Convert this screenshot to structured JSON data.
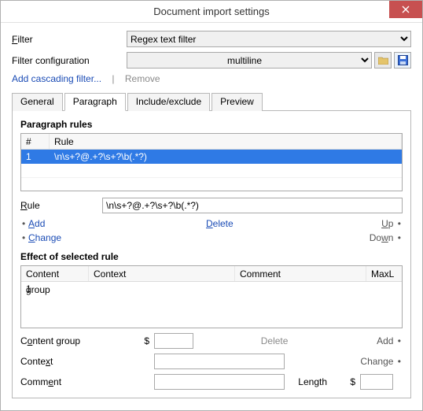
{
  "window": {
    "title": "Document import settings"
  },
  "filter_row": {
    "label": "Filter",
    "hotchar": "F",
    "value": "Regex text filter"
  },
  "filter_config_row": {
    "label": "Filter configuration",
    "value": "multiline"
  },
  "linkbar": {
    "add_cascading": "Add cascading filter...",
    "sep": "|",
    "remove": "Remove"
  },
  "tabs": {
    "general": "General",
    "paragraph": "Paragraph",
    "include": "Include/exclude",
    "preview": "Preview"
  },
  "para_rules": {
    "title": "Paragraph rules",
    "header_hash": "#",
    "header_rule": "Rule",
    "rows": [
      {
        "num": "1",
        "rule": "\\n\\s+?@.+?\\s+?\\b(.*?)"
      }
    ]
  },
  "rule_edit": {
    "label": "Rule",
    "hotchar": "R",
    "value": "\\n\\s+?@.+?\\s+?\\b(.*?)"
  },
  "rule_actions": {
    "add": "Add",
    "change": "Change",
    "delete": "Delete",
    "up": "Up",
    "down": "Down"
  },
  "effects": {
    "title": "Effect of selected rule",
    "header_group": "Content group",
    "header_context": "Context",
    "header_comment": "Comment",
    "header_maxl": "MaxL",
    "rows": [
      {
        "group": "1",
        "context": "",
        "comment": "",
        "maxl": ""
      }
    ]
  },
  "eff_form": {
    "content_group_label": "Content group",
    "hot_cg": "o",
    "context_label": "Context",
    "hot_cx": "x",
    "comment_label": "Comment",
    "hot_cm": "e",
    "length_label": "Length",
    "dollar": "$",
    "cg_value": "",
    "cx_value": "",
    "cm_value": "",
    "len_value": ""
  },
  "eff_actions": {
    "delete": "Delete",
    "add": "Add",
    "change": "Change"
  }
}
